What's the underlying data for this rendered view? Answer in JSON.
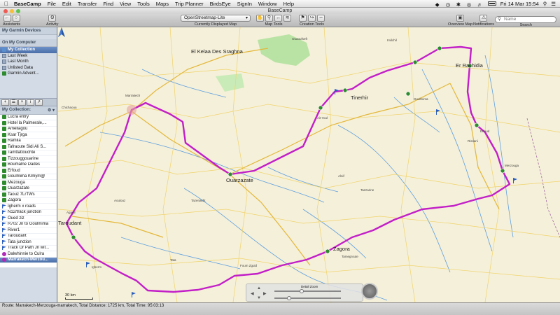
{
  "menubar": {
    "app": "BaseCamp",
    "items": [
      "File",
      "Edit",
      "Transfer",
      "Find",
      "View",
      "Tools",
      "Maps",
      "Trip Planner",
      "BirdsEye",
      "SignIn",
      "Window",
      "Help"
    ],
    "clock": "Fri 14 Mar  15:54"
  },
  "window": {
    "title": "BaseCamp"
  },
  "toolbar": {
    "assistants": "Assistants",
    "activity": "Activity",
    "map_select": "OpenStreetmap-Lite",
    "map_label": "Currently Displayed Map",
    "map_tools": "Map Tools",
    "creation_tools": "Creation Tools",
    "overview_map": "Overview Map",
    "notifications": "Notifications",
    "search_label": "Search",
    "search_placeholder": "Name"
  },
  "sidebar": {
    "devices_header": "My Garmin Devices",
    "computer_header": "On My Computer",
    "library": [
      {
        "label": "My Collection",
        "icon": "folder-icon"
      },
      {
        "label": "Last Week",
        "icon": "list-icon"
      },
      {
        "label": "Last Month",
        "icon": "list-icon"
      },
      {
        "label": "Unlisted Data",
        "icon": "list-icon"
      },
      {
        "label": "Garmin Advent...",
        "icon": "adventure-icon"
      }
    ],
    "collection_header": "My Collection:",
    "collection": [
      {
        "label": "Lucra entry",
        "icon": "waypoint-icon"
      },
      {
        "label": "Hotel la Palmerale,...",
        "icon": "waypoint-icon"
      },
      {
        "label": "Amellagou",
        "icon": "waypoint-icon"
      },
      {
        "label": "Ksar Tjrga",
        "icon": "waypoint-icon"
      },
      {
        "label": "Ramlia",
        "icon": "waypoint-icon"
      },
      {
        "label": "Tafraoute Sidi Ali S...",
        "icon": "waypoint-icon"
      },
      {
        "label": "Tamttattouchte",
        "icon": "waypoint-icon"
      },
      {
        "label": "Tizzouggouarine",
        "icon": "waypoint-icon"
      },
      {
        "label": "Boumalne Dades",
        "icon": "waypoint-icon"
      },
      {
        "label": "Erfoud",
        "icon": "waypoint-icon"
      },
      {
        "label": "Goulmima Klmym@",
        "icon": "waypoint-icon"
      },
      {
        "label": "Mezouga",
        "icon": "waypoint-icon"
      },
      {
        "label": "Ouarzazate",
        "icon": "waypoint-icon"
      },
      {
        "label": "Taouz 7LrTWs",
        "icon": "waypoint-icon"
      },
      {
        "label": "Zagora",
        "icon": "waypoint-icon"
      },
      {
        "label": "Igherm x roads",
        "icon": "flag-icon"
      },
      {
        "label": "N12/track junction",
        "icon": "flag-icon"
      },
      {
        "label": "Oued ziz",
        "icon": "flag-icon"
      },
      {
        "label": "R702 Jn to Goulmima",
        "icon": "flag-icon"
      },
      {
        "label": "River1",
        "icon": "flag-icon"
      },
      {
        "label": "Taroudant",
        "icon": "flag-icon"
      },
      {
        "label": "Tata junction",
        "icon": "flag-icon"
      },
      {
        "label": "Track Or Path Jn wit...",
        "icon": "flag-icon"
      },
      {
        "label": "Dalwhinnie to Culra",
        "icon": "route-icon"
      },
      {
        "label": "Marrakech-Merzou...",
        "icon": "route-icon",
        "selected": true
      }
    ]
  },
  "map": {
    "labels_big": [
      {
        "t": "El Kelaa Des Sraghna"
      },
      {
        "t": "Ouarzazate"
      },
      {
        "t": "Tinerhir"
      },
      {
        "t": "Er Rachidia"
      },
      {
        "t": "Taroudant"
      },
      {
        "t": "Zagora"
      }
    ],
    "labels_small": [
      "Marrakech",
      "Chichaoua",
      "Ouaoufseft",
      "Imilchil",
      "Ait Youl",
      "Tazzarine",
      "Erfoud",
      "Merzouga",
      "Goulmima",
      "Tata",
      "Igherm",
      "Agadir",
      "Tamegroute",
      "Alnif",
      "Rissani",
      "Aoulouz",
      "Tazenakht",
      "Foum Zguid"
    ],
    "scale": "30 km",
    "zoom_label": "Detail Zoom"
  },
  "status": {
    "text": "Route: Marrakech-Merzouga-marrakech, Total Distance: 1725 km, Total Time: 95:03:13"
  },
  "colors": {
    "route": "#c21fc8",
    "road_major": "#e8c74a",
    "road_minor": "#f5dd8a",
    "water": "#5e9fe0",
    "land": "#f5f0d9",
    "park": "#b9e3a5",
    "selection": "#4a6fa8"
  }
}
